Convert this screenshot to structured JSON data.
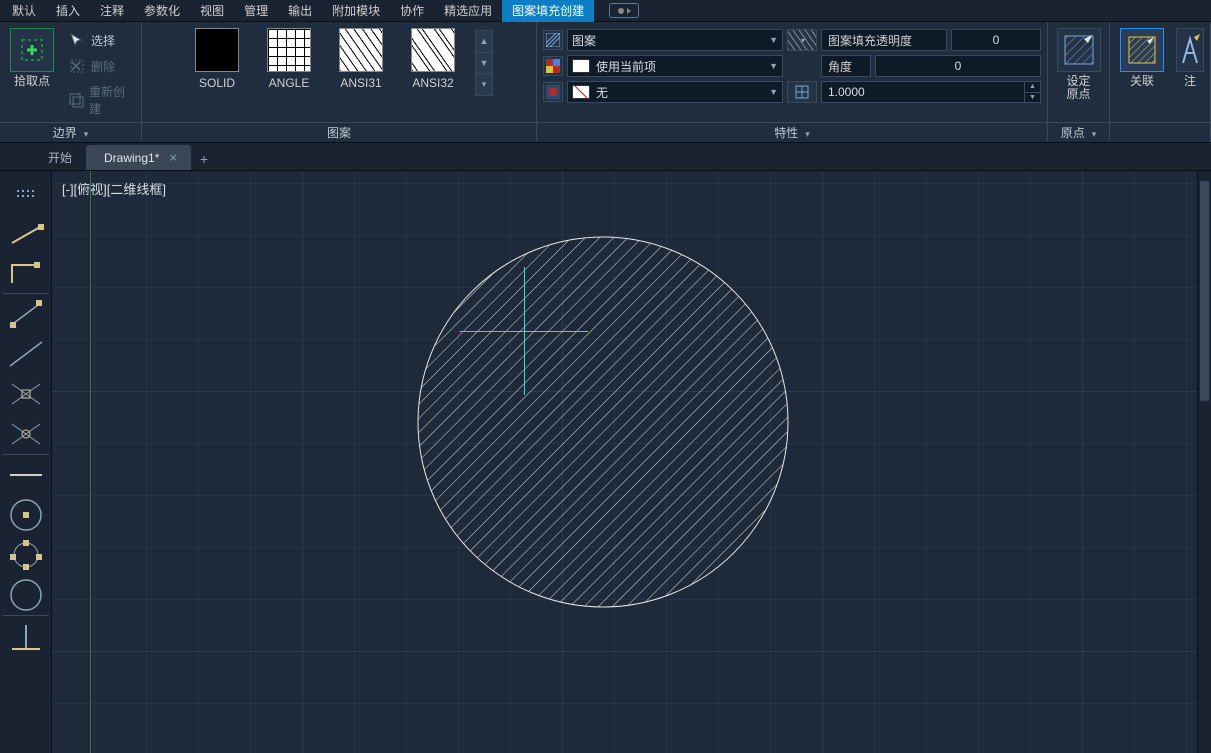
{
  "menu": {
    "items": [
      "默认",
      "插入",
      "注释",
      "参数化",
      "视图",
      "管理",
      "输出",
      "附加模块",
      "协作",
      "精选应用",
      "图案填充创建"
    ],
    "active": "图案填充创建"
  },
  "ribbon": {
    "boundary": {
      "title": "边界",
      "pickPoint": "拾取点",
      "select": "选择",
      "delete": "删除",
      "recreate": "重新创建"
    },
    "pattern": {
      "title": "图案",
      "items": [
        "SOLID",
        "ANGLE",
        "ANSI31",
        "ANSI32"
      ]
    },
    "properties": {
      "title": "特性",
      "typeLabel": "图案",
      "transparencyLabel": "图案填充透明度",
      "transparencyValue": "0",
      "colorLabel": "使用当前项",
      "angleLabel": "角度",
      "angleValue": "0",
      "bgLabel": "无",
      "scaleValue": "1.0000"
    },
    "origin": {
      "title": "原点",
      "btn": "设定\n原点"
    },
    "options": {
      "assoc": "关联",
      "annot": "注"
    }
  },
  "tabs": {
    "start": "开始",
    "doc": "Drawing1*"
  },
  "viewport": {
    "label": "[-][俯视][二维线框]"
  }
}
